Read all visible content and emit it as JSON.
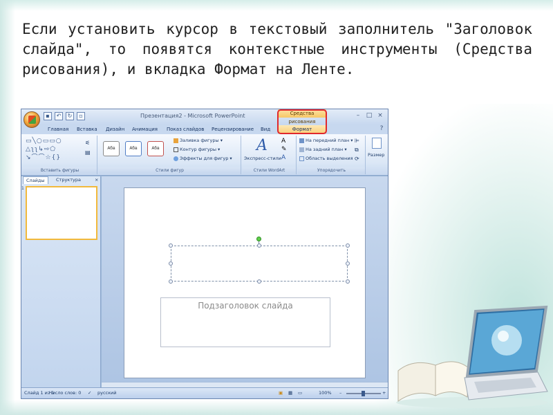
{
  "slide_text": "Если установить курсор в текстовый заполнитель \"Заголовок слайда\", то появятся контекстные инструменты (Средства рисования), и вкладка Формат на Ленте.",
  "window": {
    "title": "Презентация2 - Microsoft PowerPoint",
    "context_tools_label": "Средства рисования",
    "controls": [
      "–",
      "□",
      "×"
    ]
  },
  "tabs": [
    "Главная",
    "Вставка",
    "Дизайн",
    "Анимация",
    "Показ слайдов",
    "Рецензирование",
    "Вид",
    "Формат"
  ],
  "ribbon": {
    "groups": {
      "insert_shapes": "Вставить фигуры",
      "shape_styles": "Стили фигур",
      "wordart_styles": "Стили WordArt",
      "arrange": "Упорядочить"
    },
    "style_samples": [
      "Абв",
      "Абв",
      "Абв"
    ],
    "shape_fill": "Заливка фигуры",
    "shape_outline": "Контур фигуры",
    "shape_effects": "Эффекты для фигур",
    "express_styles": "Экспресс-стили",
    "bring_front": "На передний план",
    "send_back": "На задний план",
    "selection_pane": "Область выделения",
    "size": "Размер"
  },
  "panel": {
    "tab_slides": "Слайды",
    "tab_outline": "Структура",
    "close": "×",
    "thumb_number": "1"
  },
  "slide": {
    "subtitle_placeholder": "Подзаголовок слайда"
  },
  "status": {
    "slide_info": "Слайд 1 из 1",
    "word_count": "Число слов: 0",
    "language": "русский",
    "zoom": "100%"
  },
  "colors": {
    "highlight": "#e0282c",
    "context_tab": "#f9cf7a",
    "ribbon": "#dbe7f6"
  }
}
